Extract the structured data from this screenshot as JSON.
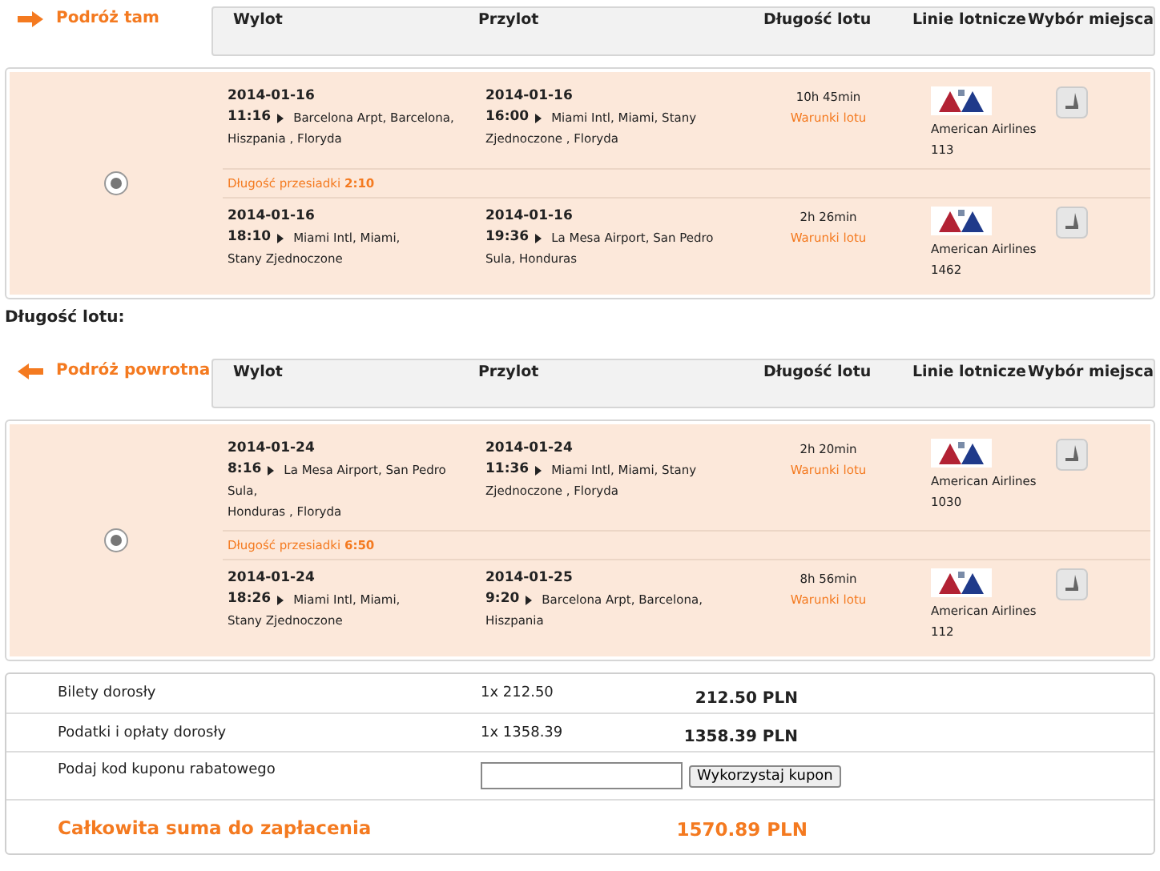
{
  "legs": [
    {
      "kind": "outbound",
      "title": "Podróż tam",
      "columns": [
        "Wylot",
        "Przylot",
        "Długość lotu",
        "Linie lotnicze",
        "Wybór miejsca"
      ],
      "selected": true,
      "segments": [
        {
          "dep_date": "2014-01-16",
          "dep_time": "11:16",
          "dep_place": [
            "Barcelona Arpt, Barcelona,",
            "Hiszpania , Floryda"
          ],
          "arr_date": "2014-01-16",
          "arr_time": "16:00",
          "arr_place": [
            "Miami Intl, Miami, Stany",
            "Zjednoczone , Floryda"
          ],
          "duration": "10h 45min",
          "conditions": "Warunki lotu",
          "airline": "American Airlines",
          "flight": "113"
        },
        {
          "dep_date": "2014-01-16",
          "dep_time": "18:10",
          "dep_place": [
            "Miami Intl, Miami,",
            "Stany Zjednoczone"
          ],
          "arr_date": "2014-01-16",
          "arr_time": "19:36",
          "arr_place": [
            "La Mesa Airport, San Pedro",
            "Sula, Honduras"
          ],
          "duration": "2h 26min",
          "conditions": "Warunki lotu",
          "airline": "American Airlines",
          "flight": "1462"
        }
      ],
      "layover": "Długość przesiadki **2:10**"
    },
    {
      "kind": "return",
      "title": "Podróż powrotna",
      "columns": [
        "Wylot",
        "Przylot",
        "Długość lotu",
        "Linie lotnicze",
        "Wybór miejsca"
      ],
      "selected": true,
      "segments": [
        {
          "dep_date": "2014-01-24",
          "dep_time": "8:16",
          "dep_place": [
            "La Mesa Airport, San Pedro",
            "Sula,",
            "Honduras , Floryda"
          ],
          "arr_date": "2014-01-24",
          "arr_time": "11:36",
          "arr_place": [
            "Miami Intl, Miami, Stany",
            "Zjednoczone , Floryda"
          ],
          "duration": "2h 20min",
          "conditions": "Warunki lotu",
          "airline": "American Airlines",
          "flight": "1030"
        },
        {
          "dep_date": "2014-01-24",
          "dep_time": "18:26",
          "dep_place": [
            "Miami Intl, Miami,",
            "Stany Zjednoczone"
          ],
          "arr_date": "2014-01-25",
          "arr_time": "9:20",
          "arr_place": [
            "Barcelona Arpt, Barcelona,",
            "Hiszpania"
          ],
          "duration": "8h 56min",
          "conditions": "Warunki lotu",
          "airline": "American Airlines",
          "flight": "112"
        }
      ],
      "layover": "Długość przesiadki **6:50**"
    }
  ],
  "between_label": "Długość lotu:",
  "pricing": {
    "rows": [
      {
        "kind": "price",
        "label": "Bilety dorosły",
        "unit": "1x 212.50",
        "amount": "212.50 PLN"
      },
      {
        "kind": "price",
        "label": "Podatki i opłaty dorosły",
        "unit": "1x 1358.39",
        "amount": "1358.39 PLN"
      },
      {
        "kind": "coupon",
        "label": "Podaj kod kuponu rabatowego",
        "button": "Wykorzystaj kupon"
      },
      {
        "kind": "total",
        "label": "Całkowita suma do zapłacenia",
        "amount": "1570.89 PLN"
      }
    ]
  }
}
